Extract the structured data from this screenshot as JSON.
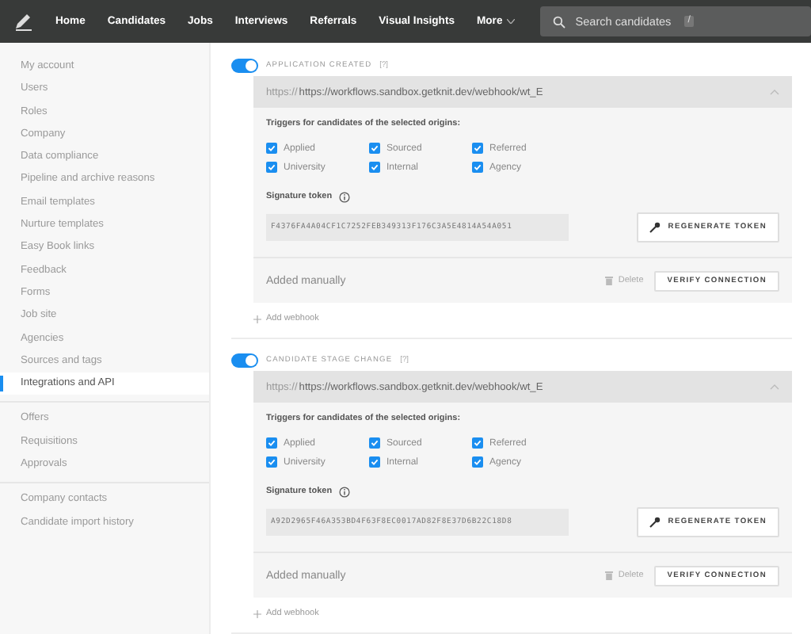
{
  "nav": {
    "items": [
      {
        "label": "Home"
      },
      {
        "label": "Candidates"
      },
      {
        "label": "Jobs"
      },
      {
        "label": "Interviews"
      },
      {
        "label": "Referrals"
      },
      {
        "label": "Visual Insights"
      }
    ],
    "more": "More",
    "search": {
      "placeholder": "Search candidates",
      "shortcut": "/"
    }
  },
  "sidebar": {
    "groups": [
      {
        "items": [
          {
            "label": "My account",
            "selected": false
          },
          {
            "label": "Users",
            "selected": false
          },
          {
            "label": "Roles",
            "selected": false
          },
          {
            "label": "Company",
            "selected": false
          },
          {
            "label": "Data compliance",
            "selected": false
          },
          {
            "label": "Pipeline and archive reasons",
            "selected": false
          },
          {
            "label": "Email templates",
            "selected": false
          },
          {
            "label": "Nurture templates",
            "selected": false
          },
          {
            "label": "Easy Book links",
            "selected": false
          },
          {
            "label": "Feedback",
            "selected": false
          },
          {
            "label": "Forms",
            "selected": false
          },
          {
            "label": "Job site",
            "selected": false
          },
          {
            "label": "Agencies",
            "selected": false
          },
          {
            "label": "Sources and tags",
            "selected": false
          },
          {
            "label": "Integrations and API",
            "selected": true
          }
        ]
      },
      {
        "items": [
          {
            "label": "Offers",
            "selected": false
          },
          {
            "label": "Requisitions",
            "selected": false
          },
          {
            "label": "Approvals",
            "selected": false
          }
        ]
      },
      {
        "items": [
          {
            "label": "Company contacts",
            "selected": false
          },
          {
            "label": "Candidate import history",
            "selected": false
          }
        ]
      }
    ]
  },
  "webhooks": [
    {
      "event": "APPLICATION CREATED",
      "help": "[?]",
      "on": true,
      "url_prefix": "https://",
      "url": "https://workflows.sandbox.getknit.dev/webhook/wt_E",
      "triggers_label": "Triggers for candidates of the selected origins:",
      "origins": [
        {
          "label": "Applied",
          "checked": true
        },
        {
          "label": "Sourced",
          "checked": true
        },
        {
          "label": "Referred",
          "checked": true
        },
        {
          "label": "University",
          "checked": true
        },
        {
          "label": "Internal",
          "checked": true
        },
        {
          "label": "Agency",
          "checked": true
        }
      ],
      "token_label": "Signature token",
      "token": "F4376FA4A04CF1C7252FEB349313F176C3A5E4814A54A051",
      "regenerate": "REGENERATE TOKEN",
      "source": "Added manually",
      "delete": "Delete",
      "verify": "VERIFY CONNECTION",
      "add": "Add webhook"
    },
    {
      "event": "CANDIDATE STAGE CHANGE",
      "help": "[?]",
      "on": true,
      "url_prefix": "https://",
      "url": "https://workflows.sandbox.getknit.dev/webhook/wt_E",
      "triggers_label": "Triggers for candidates of the selected origins:",
      "origins": [
        {
          "label": "Applied",
          "checked": true
        },
        {
          "label": "Sourced",
          "checked": true
        },
        {
          "label": "Referred",
          "checked": true
        },
        {
          "label": "University",
          "checked": true
        },
        {
          "label": "Internal",
          "checked": true
        },
        {
          "label": "Agency",
          "checked": true
        }
      ],
      "token_label": "Signature token",
      "token": "A92D2965F46A353BD4F63F8EC0017AD82F8E37D6B22C18D8",
      "regenerate": "REGENERATE TOKEN",
      "source": "Added manually",
      "delete": "Delete",
      "verify": "VERIFY CONNECTION",
      "add": "Add webhook"
    }
  ]
}
